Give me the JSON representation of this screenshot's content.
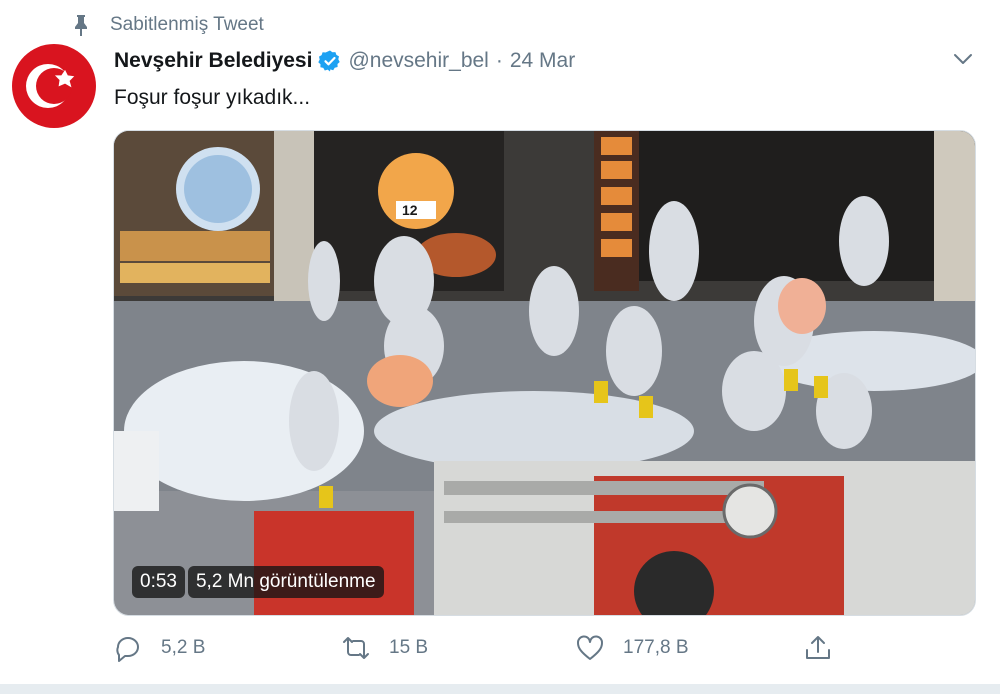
{
  "pinned": {
    "label": "Sabitlenmiş Tweet",
    "icon": "pin-icon"
  },
  "author": {
    "display_name": "Nevşehir Belediyesi",
    "handle": "@nevsehir_bel",
    "separator": "·",
    "date": "24 Mar",
    "verified": true,
    "avatar_icon": "turkish-flag-avatar"
  },
  "tweet": {
    "text": "Foşur foşur yıkadık..."
  },
  "video": {
    "duration": "0:53",
    "views": "5,2 Mn görüntülenme",
    "sign_text": "12"
  },
  "actions": {
    "reply_count": "5,2 B",
    "retweet_count": "15 B",
    "like_count": "177,8 B"
  },
  "colors": {
    "verified_blue": "#1da1f2",
    "secondary_text": "#657786",
    "flag_red": "#e30a17"
  }
}
